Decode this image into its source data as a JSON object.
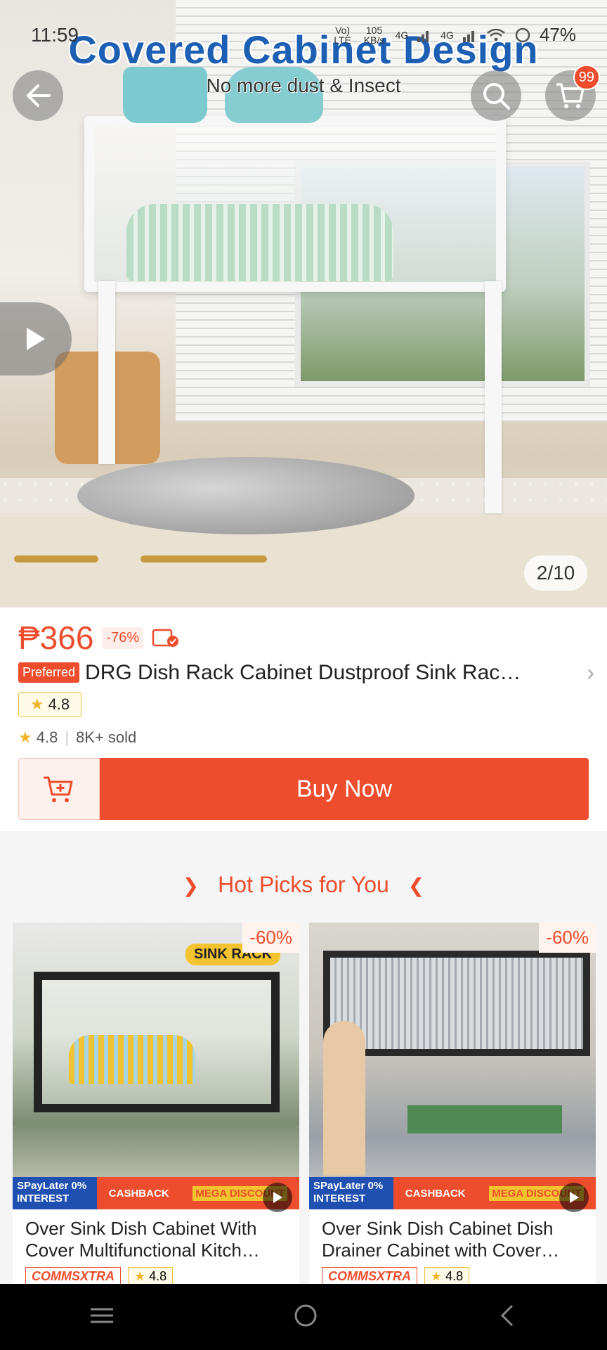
{
  "status_bar": {
    "time": "11:59",
    "network_left": "Vo) LTE",
    "speed": "105 KB/s",
    "sig1": "4G",
    "sig2": "4G",
    "battery": "47%"
  },
  "hero": {
    "headline": "Covered Cabinet Design",
    "subline": "No more dust & Insect",
    "cart_badge": "99",
    "image_counter": "2/10"
  },
  "product": {
    "price": "₱366",
    "discount": "-76%",
    "preferred_label": "Preferred",
    "title": "DRG Dish Rack Cabinet  Dustproof Sink Rac…",
    "rating_box": "4.8",
    "rating": "4.8",
    "sold": "8K+ sold",
    "buy_now": "Buy Now"
  },
  "hot_picks": {
    "title": "Hot Picks for You",
    "items": [
      {
        "discount": "-60%",
        "name": "Over Sink Dish Cabinet With Cover Multifunctional Kitch…",
        "promo_a": "SPayLater 0% INTEREST",
        "promo_b1": "CASHBACK",
        "promo_b2": "MEGA DISCOUNT",
        "image_text": "SINK RACK",
        "tag": "COMMSXTRA",
        "rating": "4.8"
      },
      {
        "discount": "-60%",
        "name": "Over Sink Dish Cabinet Dish Drainer Cabinet with Cover…",
        "promo_a": "SPayLater 0% INTEREST",
        "promo_b1": "CASHBACK",
        "promo_b2": "MEGA DISCOUNT",
        "tag": "COMMSXTRA",
        "rating": "4.8"
      }
    ]
  },
  "colors": {
    "accent": "#ee4d2d",
    "headline_blue": "#1d5fb3",
    "star": "#f0b429"
  }
}
